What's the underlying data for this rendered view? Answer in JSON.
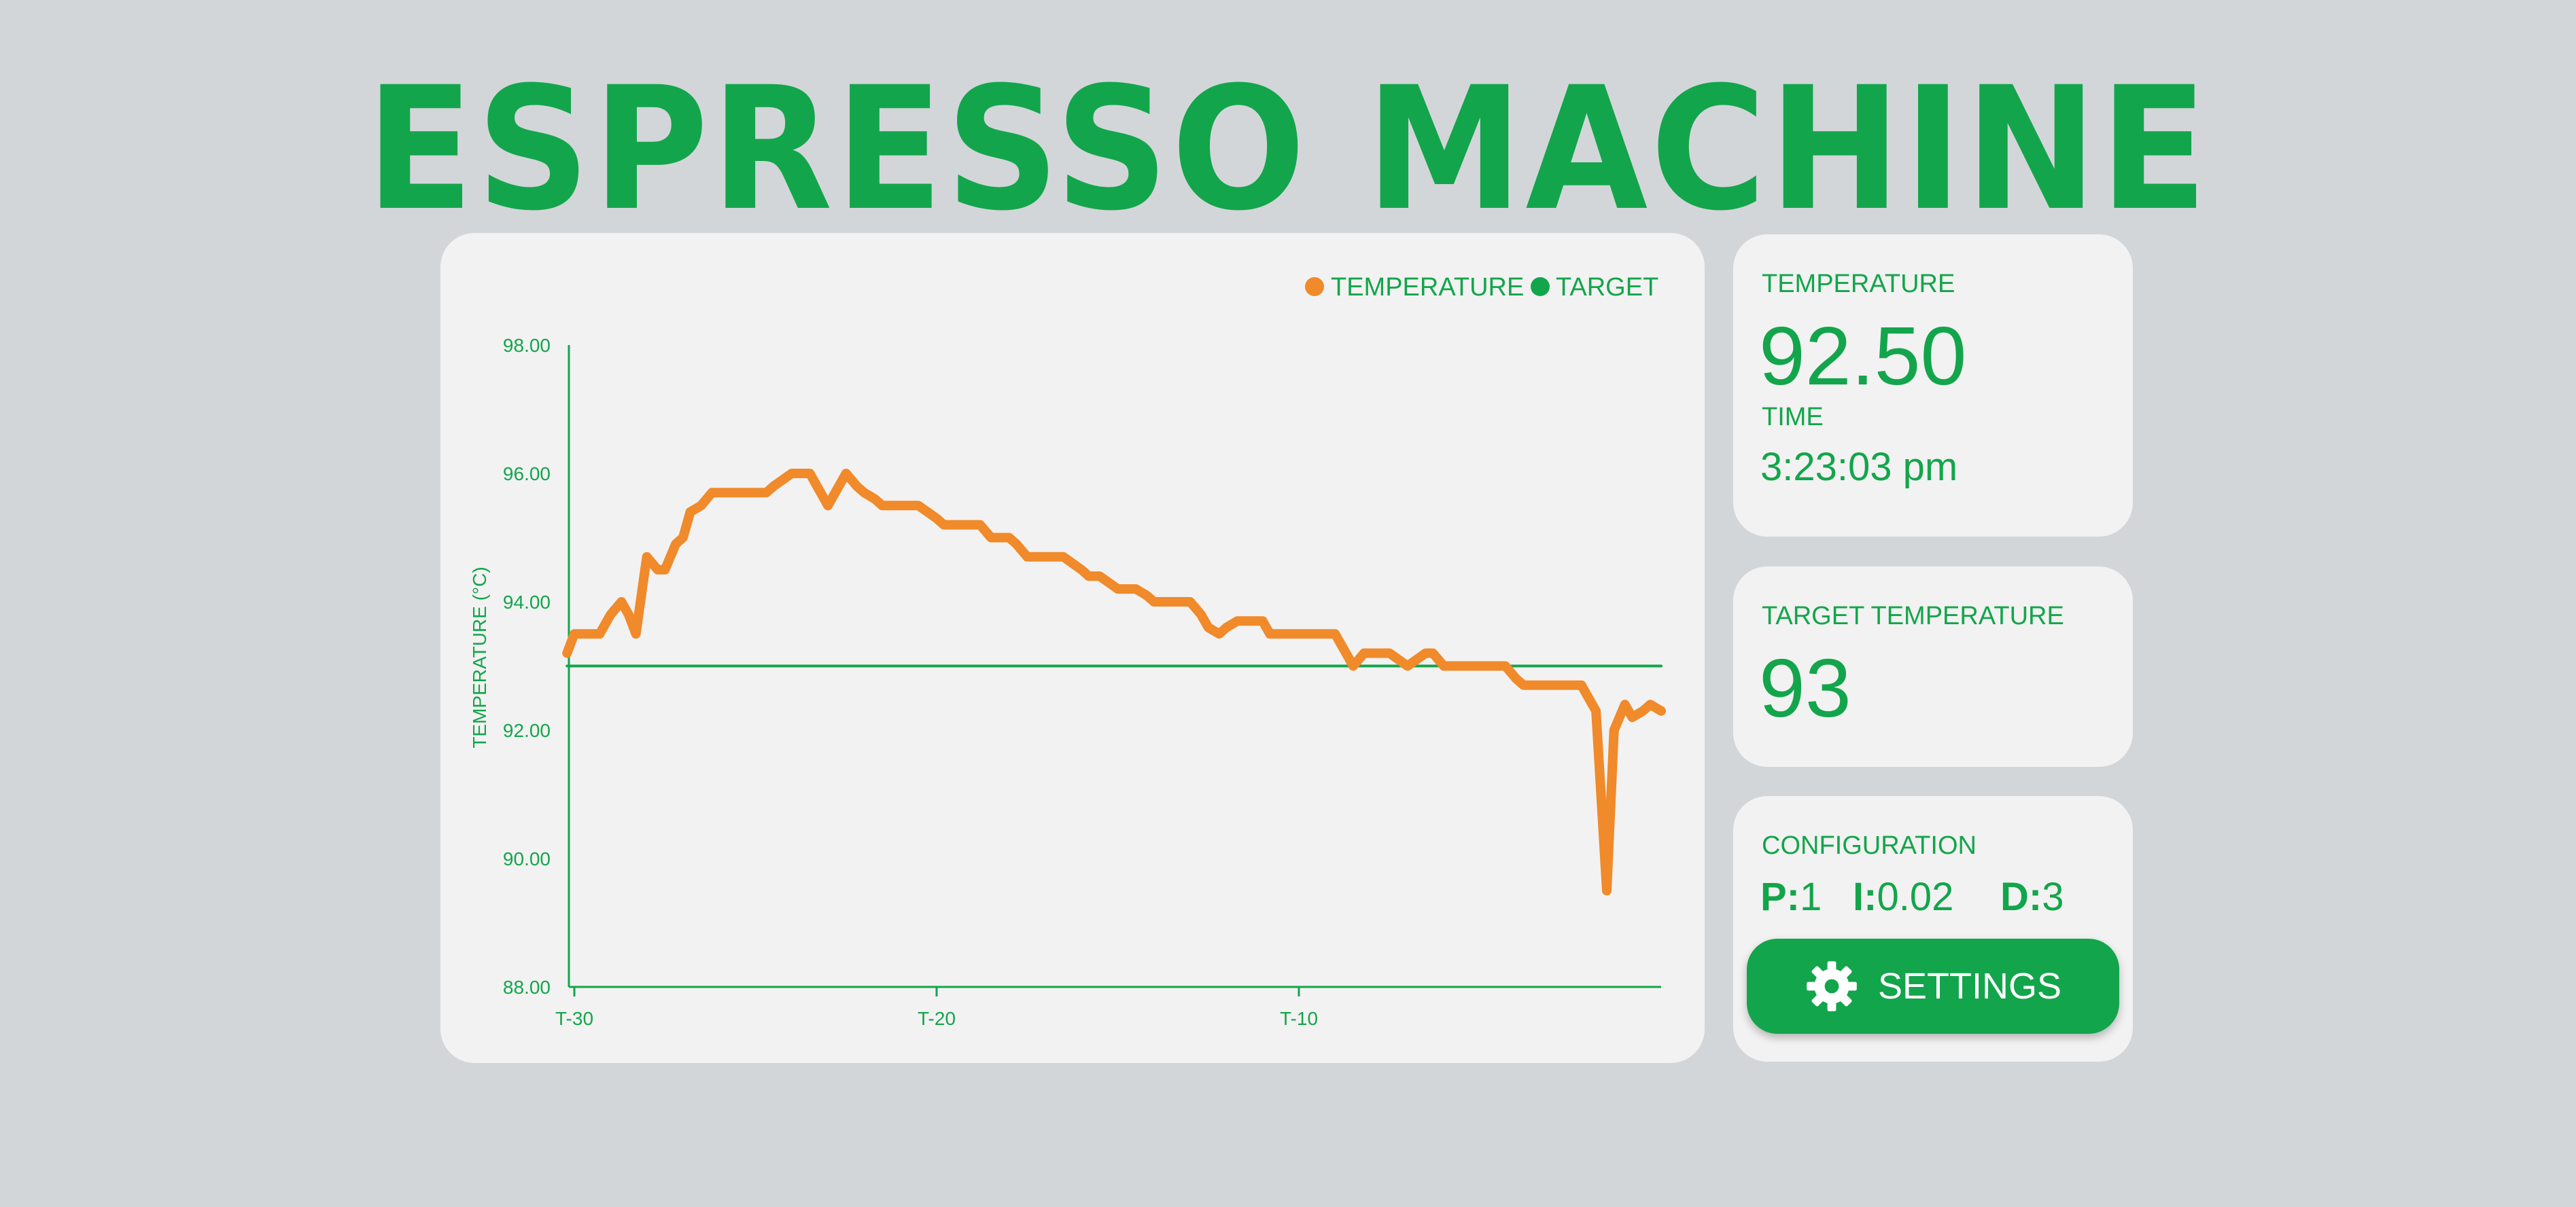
{
  "app": {
    "title": "ESPRESSO MACHINE"
  },
  "colors": {
    "brand_green": "#13a54b",
    "temperature_orange": "#f08a2a",
    "card_bg": "#f2f2f2",
    "page_bg": "#d2d6d9"
  },
  "status": {
    "temperature_label": "TEMPERATURE",
    "temperature_value": "92.50",
    "time_label": "TIME",
    "time_value": "3:23:03 pm"
  },
  "target": {
    "label": "TARGET TEMPERATURE",
    "value": "93"
  },
  "configuration": {
    "label": "CONFIGURATION",
    "p_key": "P:",
    "p_value": "1",
    "i_key": "I:",
    "i_value": "0.02",
    "d_key": "D:",
    "d_value": "3",
    "settings_label": "SETTINGS",
    "settings_icon": "gear-icon"
  },
  "chart_data": {
    "type": "line",
    "ylabel": "TEMPERATURE (°C)",
    "ylim": [
      88,
      98
    ],
    "y_ticks": [
      "98.00",
      "96.00",
      "94.00",
      "92.00",
      "90.00",
      "88.00"
    ],
    "xlim": [
      -30,
      0
    ],
    "x_ticks": [
      {
        "value": -30,
        "label": "T-30"
      },
      {
        "value": -20,
        "label": "T-20"
      },
      {
        "value": -10,
        "label": "T-10"
      }
    ],
    "legend_position": "top-right",
    "series": [
      {
        "name": "TEMPERATURE",
        "color": "#f08a2a",
        "x": [
          -30.2,
          -30.0,
          -29.5,
          -29.3,
          -29.0,
          -28.7,
          -28.5,
          -28.3,
          -28.0,
          -27.7,
          -27.5,
          -27.2,
          -27.0,
          -26.8,
          -26.5,
          -26.2,
          -26.0,
          -25.5,
          -25.0,
          -24.7,
          -24.5,
          -24.0,
          -23.7,
          -23.5,
          -23.2,
          -23.0,
          -22.8,
          -22.5,
          -22.2,
          -22.0,
          -21.7,
          -21.5,
          -21.0,
          -20.8,
          -20.5,
          -20.0,
          -19.8,
          -19.5,
          -19.0,
          -18.8,
          -18.5,
          -18.0,
          -17.8,
          -17.5,
          -17.0,
          -16.8,
          -16.5,
          -16.0,
          -15.8,
          -15.5,
          -15.0,
          -14.8,
          -14.5,
          -14.2,
          -14.0,
          -13.7,
          -13.5,
          -13.0,
          -12.7,
          -12.5,
          -12.2,
          -12.0,
          -11.7,
          -11.5,
          -11.0,
          -10.8,
          -10.5,
          -10.3,
          -10.0,
          -9.7,
          -9.5,
          -9.0,
          -8.8,
          -8.5,
          -8.2,
          -8.0,
          -7.8,
          -7.5,
          -7.0,
          -6.5,
          -6.3,
          -6.0,
          -5.5,
          -5.0,
          -4.5,
          -4.3,
          -4.0,
          -3.8,
          -3.5,
          -3.3,
          -3.0,
          -2.8,
          -2.5,
          -2.2,
          -2.0,
          -1.8,
          -1.5,
          -1.3,
          -1.0,
          -0.8,
          -0.5,
          -0.3,
          0.0
        ],
        "values": [
          93.2,
          93.5,
          93.5,
          93.5,
          93.8,
          94.0,
          93.8,
          93.5,
          94.7,
          94.5,
          94.5,
          94.9,
          95.0,
          95.4,
          95.5,
          95.7,
          95.7,
          95.7,
          95.7,
          95.7,
          95.8,
          96.0,
          96.0,
          96.0,
          95.7,
          95.5,
          95.7,
          96.0,
          95.8,
          95.7,
          95.6,
          95.5,
          95.5,
          95.5,
          95.5,
          95.3,
          95.2,
          95.2,
          95.2,
          95.2,
          95.0,
          95.0,
          94.9,
          94.7,
          94.7,
          94.7,
          94.7,
          94.5,
          94.4,
          94.4,
          94.2,
          94.2,
          94.2,
          94.1,
          94.0,
          94.0,
          94.0,
          94.0,
          93.8,
          93.6,
          93.5,
          93.6,
          93.7,
          93.7,
          93.7,
          93.5,
          93.5,
          93.5,
          93.5,
          93.5,
          93.5,
          93.5,
          93.3,
          93.0,
          93.2,
          93.2,
          93.2,
          93.2,
          93.0,
          93.2,
          93.2,
          93.0,
          93.0,
          93.0,
          93.0,
          93.0,
          92.8,
          92.7,
          92.7,
          92.7,
          92.7,
          92.7,
          92.7,
          92.7,
          92.5,
          92.3,
          89.5,
          92.0,
          92.4,
          92.2,
          92.3,
          92.4,
          92.3
        ]
      },
      {
        "name": "TARGET",
        "color": "#13a54b",
        "x": [
          -30.2,
          0
        ],
        "values": [
          93,
          93
        ]
      }
    ]
  }
}
